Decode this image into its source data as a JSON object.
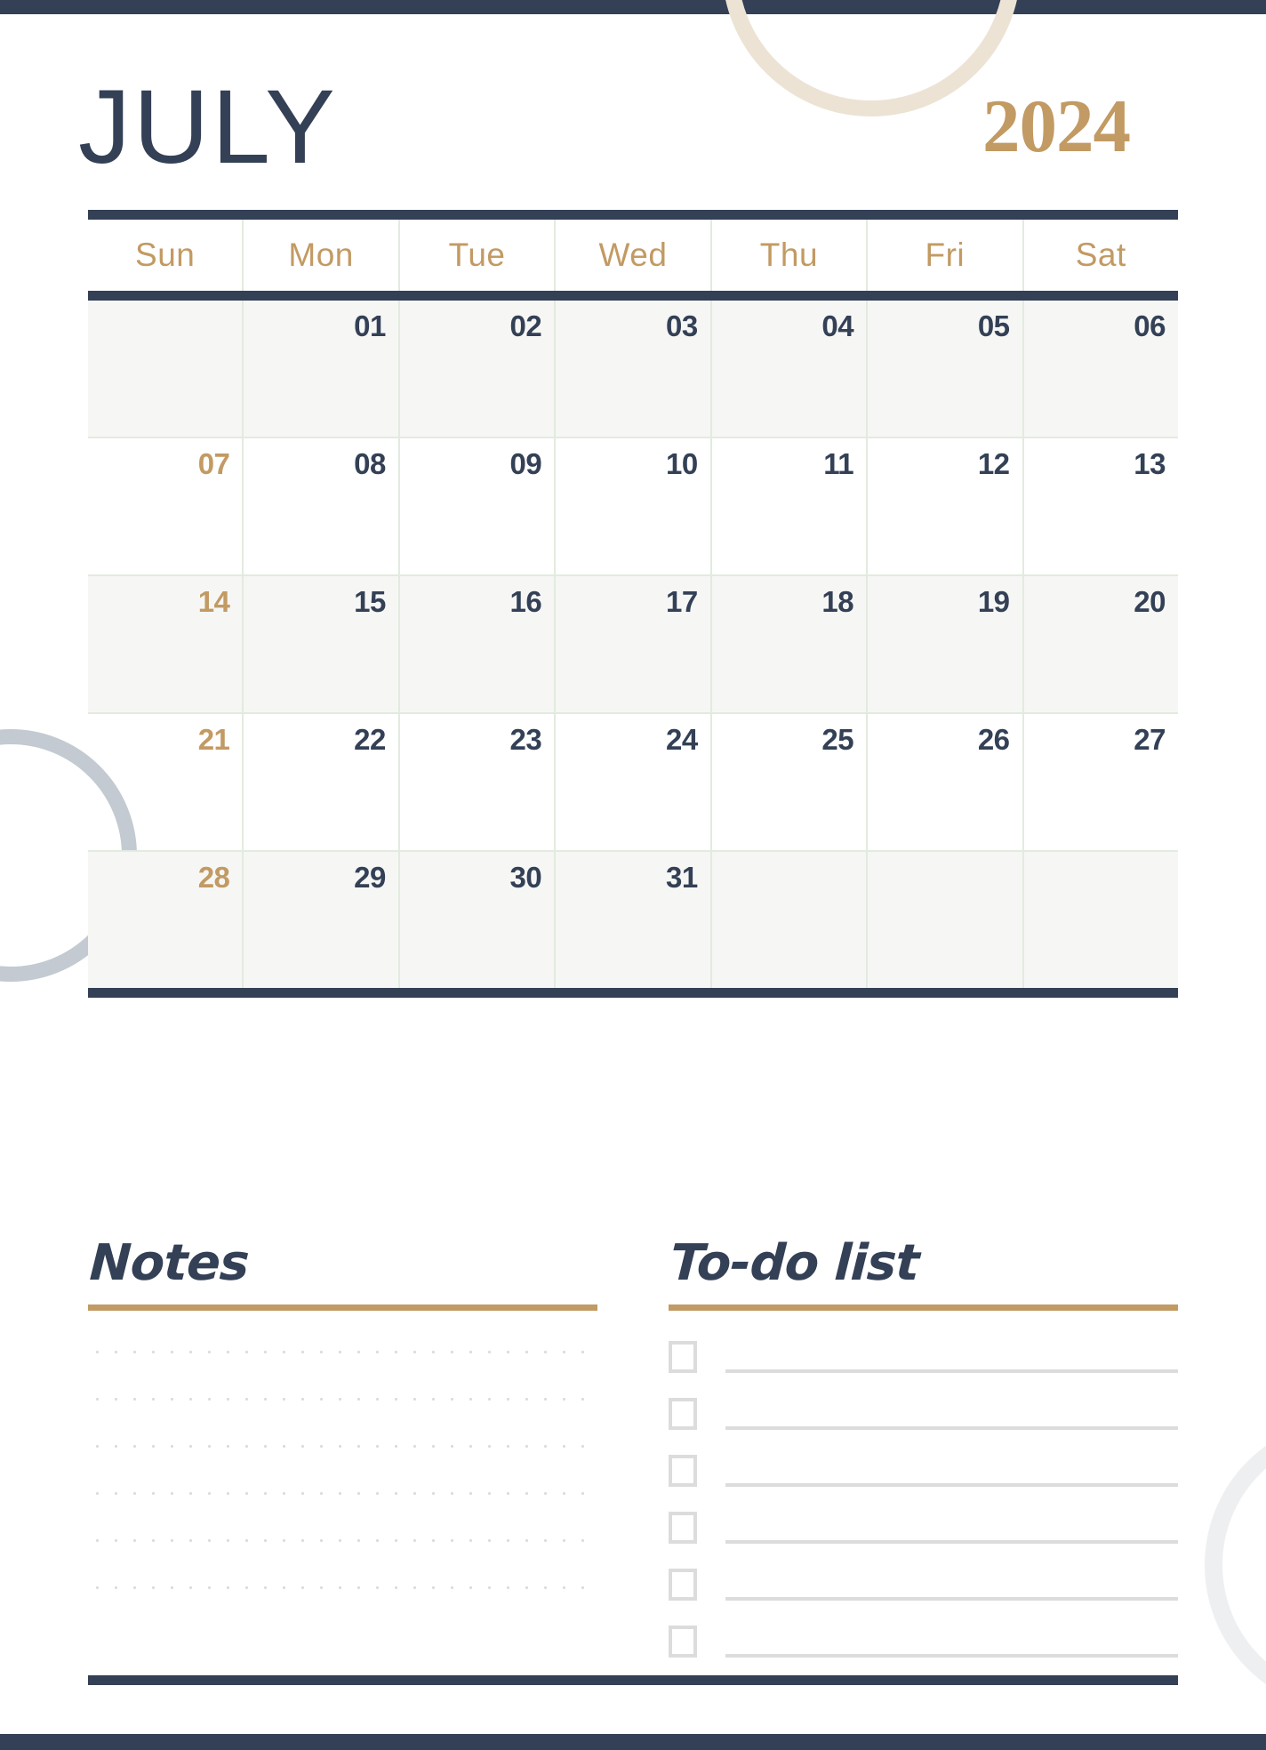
{
  "page": {
    "month": "JULY",
    "year": "2024",
    "colors": {
      "navy": "#334055",
      "gold": "#c29a63",
      "grid_green": "#e2ebdf",
      "row_shade": "#f6f7f5",
      "line_grey": "#dcdcdc",
      "deco_cream": "#ece3d5",
      "deco_blue_grey": "#c3cad1",
      "deco_light_grey": "#eeeff0"
    }
  },
  "calendar": {
    "weekdays": [
      "Sun",
      "Mon",
      "Tue",
      "Wed",
      "Thu",
      "Fri",
      "Sat"
    ],
    "weeks": [
      {
        "shaded": true,
        "days": [
          "",
          "01",
          "02",
          "03",
          "04",
          "05",
          "06"
        ]
      },
      {
        "shaded": false,
        "days": [
          "07",
          "08",
          "09",
          "10",
          "11",
          "12",
          "13"
        ]
      },
      {
        "shaded": true,
        "days": [
          "14",
          "15",
          "16",
          "17",
          "18",
          "19",
          "20"
        ]
      },
      {
        "shaded": false,
        "days": [
          "21",
          "22",
          "23",
          "24",
          "25",
          "26",
          "27"
        ]
      },
      {
        "shaded": true,
        "days": [
          "28",
          "29",
          "30",
          "31",
          "",
          "",
          ""
        ]
      }
    ]
  },
  "notes": {
    "title": "Notes",
    "line_count": 6
  },
  "todo": {
    "title": "To-do list",
    "item_count": 6
  }
}
